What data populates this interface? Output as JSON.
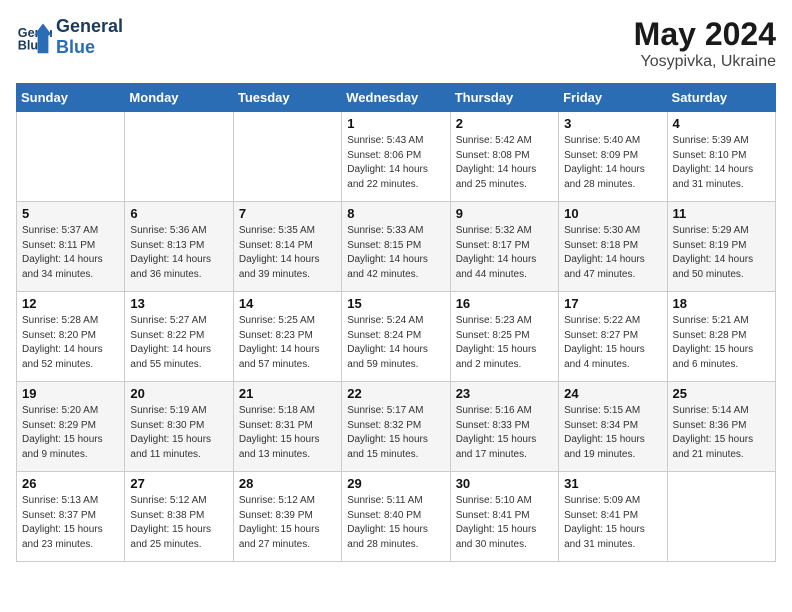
{
  "header": {
    "logo_line1": "General",
    "logo_line2": "Blue",
    "month_year": "May 2024",
    "location": "Yosypivka, Ukraine"
  },
  "weekdays": [
    "Sunday",
    "Monday",
    "Tuesday",
    "Wednesday",
    "Thursday",
    "Friday",
    "Saturday"
  ],
  "weeks": [
    [
      {
        "day": "",
        "detail": ""
      },
      {
        "day": "",
        "detail": ""
      },
      {
        "day": "",
        "detail": ""
      },
      {
        "day": "1",
        "detail": "Sunrise: 5:43 AM\nSunset: 8:06 PM\nDaylight: 14 hours\nand 22 minutes."
      },
      {
        "day": "2",
        "detail": "Sunrise: 5:42 AM\nSunset: 8:08 PM\nDaylight: 14 hours\nand 25 minutes."
      },
      {
        "day": "3",
        "detail": "Sunrise: 5:40 AM\nSunset: 8:09 PM\nDaylight: 14 hours\nand 28 minutes."
      },
      {
        "day": "4",
        "detail": "Sunrise: 5:39 AM\nSunset: 8:10 PM\nDaylight: 14 hours\nand 31 minutes."
      }
    ],
    [
      {
        "day": "5",
        "detail": "Sunrise: 5:37 AM\nSunset: 8:11 PM\nDaylight: 14 hours\nand 34 minutes."
      },
      {
        "day": "6",
        "detail": "Sunrise: 5:36 AM\nSunset: 8:13 PM\nDaylight: 14 hours\nand 36 minutes."
      },
      {
        "day": "7",
        "detail": "Sunrise: 5:35 AM\nSunset: 8:14 PM\nDaylight: 14 hours\nand 39 minutes."
      },
      {
        "day": "8",
        "detail": "Sunrise: 5:33 AM\nSunset: 8:15 PM\nDaylight: 14 hours\nand 42 minutes."
      },
      {
        "day": "9",
        "detail": "Sunrise: 5:32 AM\nSunset: 8:17 PM\nDaylight: 14 hours\nand 44 minutes."
      },
      {
        "day": "10",
        "detail": "Sunrise: 5:30 AM\nSunset: 8:18 PM\nDaylight: 14 hours\nand 47 minutes."
      },
      {
        "day": "11",
        "detail": "Sunrise: 5:29 AM\nSunset: 8:19 PM\nDaylight: 14 hours\nand 50 minutes."
      }
    ],
    [
      {
        "day": "12",
        "detail": "Sunrise: 5:28 AM\nSunset: 8:20 PM\nDaylight: 14 hours\nand 52 minutes."
      },
      {
        "day": "13",
        "detail": "Sunrise: 5:27 AM\nSunset: 8:22 PM\nDaylight: 14 hours\nand 55 minutes."
      },
      {
        "day": "14",
        "detail": "Sunrise: 5:25 AM\nSunset: 8:23 PM\nDaylight: 14 hours\nand 57 minutes."
      },
      {
        "day": "15",
        "detail": "Sunrise: 5:24 AM\nSunset: 8:24 PM\nDaylight: 14 hours\nand 59 minutes."
      },
      {
        "day": "16",
        "detail": "Sunrise: 5:23 AM\nSunset: 8:25 PM\nDaylight: 15 hours\nand 2 minutes."
      },
      {
        "day": "17",
        "detail": "Sunrise: 5:22 AM\nSunset: 8:27 PM\nDaylight: 15 hours\nand 4 minutes."
      },
      {
        "day": "18",
        "detail": "Sunrise: 5:21 AM\nSunset: 8:28 PM\nDaylight: 15 hours\nand 6 minutes."
      }
    ],
    [
      {
        "day": "19",
        "detail": "Sunrise: 5:20 AM\nSunset: 8:29 PM\nDaylight: 15 hours\nand 9 minutes."
      },
      {
        "day": "20",
        "detail": "Sunrise: 5:19 AM\nSunset: 8:30 PM\nDaylight: 15 hours\nand 11 minutes."
      },
      {
        "day": "21",
        "detail": "Sunrise: 5:18 AM\nSunset: 8:31 PM\nDaylight: 15 hours\nand 13 minutes."
      },
      {
        "day": "22",
        "detail": "Sunrise: 5:17 AM\nSunset: 8:32 PM\nDaylight: 15 hours\nand 15 minutes."
      },
      {
        "day": "23",
        "detail": "Sunrise: 5:16 AM\nSunset: 8:33 PM\nDaylight: 15 hours\nand 17 minutes."
      },
      {
        "day": "24",
        "detail": "Sunrise: 5:15 AM\nSunset: 8:34 PM\nDaylight: 15 hours\nand 19 minutes."
      },
      {
        "day": "25",
        "detail": "Sunrise: 5:14 AM\nSunset: 8:36 PM\nDaylight: 15 hours\nand 21 minutes."
      }
    ],
    [
      {
        "day": "26",
        "detail": "Sunrise: 5:13 AM\nSunset: 8:37 PM\nDaylight: 15 hours\nand 23 minutes."
      },
      {
        "day": "27",
        "detail": "Sunrise: 5:12 AM\nSunset: 8:38 PM\nDaylight: 15 hours\nand 25 minutes."
      },
      {
        "day": "28",
        "detail": "Sunrise: 5:12 AM\nSunset: 8:39 PM\nDaylight: 15 hours\nand 27 minutes."
      },
      {
        "day": "29",
        "detail": "Sunrise: 5:11 AM\nSunset: 8:40 PM\nDaylight: 15 hours\nand 28 minutes."
      },
      {
        "day": "30",
        "detail": "Sunrise: 5:10 AM\nSunset: 8:41 PM\nDaylight: 15 hours\nand 30 minutes."
      },
      {
        "day": "31",
        "detail": "Sunrise: 5:09 AM\nSunset: 8:41 PM\nDaylight: 15 hours\nand 31 minutes."
      },
      {
        "day": "",
        "detail": ""
      }
    ]
  ]
}
